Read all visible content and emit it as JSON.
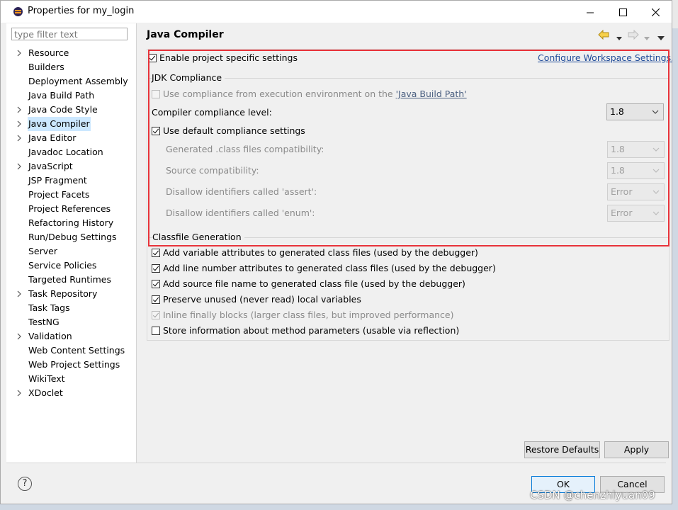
{
  "window": {
    "title": "Properties for my_login"
  },
  "filter": {
    "placeholder": "type filter text"
  },
  "tree": [
    {
      "label": "Resource",
      "arrow": true
    },
    {
      "label": "Builders",
      "arrow": false
    },
    {
      "label": "Deployment Assembly",
      "arrow": false
    },
    {
      "label": "Java Build Path",
      "arrow": false
    },
    {
      "label": "Java Code Style",
      "arrow": true
    },
    {
      "label": "Java Compiler",
      "arrow": true,
      "selected": true
    },
    {
      "label": "Java Editor",
      "arrow": true
    },
    {
      "label": "Javadoc Location",
      "arrow": false
    },
    {
      "label": "JavaScript",
      "arrow": true
    },
    {
      "label": "JSP Fragment",
      "arrow": false
    },
    {
      "label": "Project Facets",
      "arrow": false
    },
    {
      "label": "Project References",
      "arrow": false
    },
    {
      "label": "Refactoring History",
      "arrow": false
    },
    {
      "label": "Run/Debug Settings",
      "arrow": false
    },
    {
      "label": "Server",
      "arrow": false
    },
    {
      "label": "Service Policies",
      "arrow": false
    },
    {
      "label": "Targeted Runtimes",
      "arrow": false
    },
    {
      "label": "Task Repository",
      "arrow": true
    },
    {
      "label": "Task Tags",
      "arrow": false
    },
    {
      "label": "TestNG",
      "arrow": false
    },
    {
      "label": "Validation",
      "arrow": true
    },
    {
      "label": "Web Content Settings",
      "arrow": false
    },
    {
      "label": "Web Project Settings",
      "arrow": false
    },
    {
      "label": "WikiText",
      "arrow": false
    },
    {
      "label": "XDoclet",
      "arrow": true
    }
  ],
  "page": {
    "title": "Java Compiler",
    "enable_specific": "Enable project specific settings",
    "configure_link": "Configure Workspace Settings...",
    "jdk_group": "JDK Compliance",
    "use_compliance_prefix": "Use compliance from execution environment on the ",
    "use_compliance_link": "'Java Build Path'",
    "compliance_level_label": "Compiler compliance level:",
    "compliance_level_value": "1.8",
    "use_default_compliance": "Use default compliance settings",
    "generated_label": "Generated .class files compatibility:",
    "generated_value": "1.8",
    "source_label": "Source compatibility:",
    "source_value": "1.8",
    "assert_label": "Disallow identifiers called 'assert':",
    "assert_value": "Error",
    "enum_label": "Disallow identifiers called 'enum':",
    "enum_value": "Error",
    "classfile_group": "Classfile Generation",
    "cf_variable": "Add variable attributes to generated class files (used by the debugger)",
    "cf_line": "Add line number attributes to generated class files (used by the debugger)",
    "cf_source": "Add source file name to generated class file (used by the debugger)",
    "cf_preserve": "Preserve unused (never read) local variables",
    "cf_inline": "Inline finally blocks (larger class files, but improved performance)",
    "cf_store": "Store information about method parameters (usable via reflection)"
  },
  "buttons": {
    "restore_defaults": "Restore Defaults",
    "apply": "Apply",
    "ok": "OK",
    "cancel": "Cancel",
    "help": "?"
  },
  "watermark": "CSDN @chenzhiyuan09",
  "colors": {
    "selection": "#cce8ff",
    "highlight_box": "#e8333a",
    "link": "#1f4b99"
  }
}
